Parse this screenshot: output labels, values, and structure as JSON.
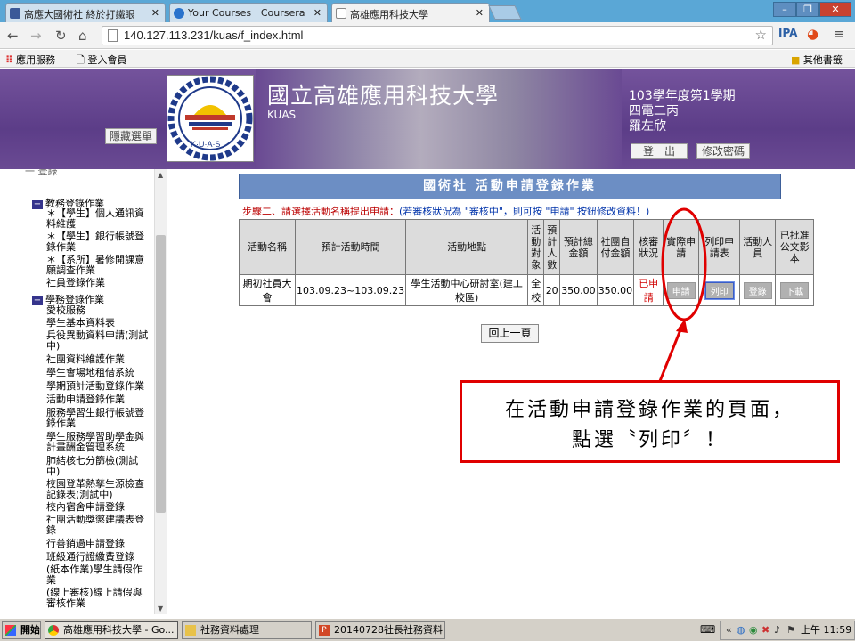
{
  "browser": {
    "tabs": [
      {
        "title": "高應大國術社 終於打鐵眼"
      },
      {
        "title": "Your Courses | Coursera"
      },
      {
        "title": "高雄應用科技大學"
      }
    ],
    "url": "140.127.113.231/kuas/f_index.html",
    "bookmarks": [
      "應用服務",
      "登入會員"
    ],
    "other_bookmarks": "其他書籤"
  },
  "banner": {
    "university": "國立高雄應用科技大學",
    "kuas": "KUAS",
    "hide_menu": "隱藏選單",
    "semester": "103學年度第1學期",
    "class": "四電二丙",
    "name": "羅左欣",
    "logout": "登　出",
    "change_password": "修改密碼"
  },
  "sidebar": {
    "truncated": "一 登錄",
    "sections": [
      {
        "title": "教務登錄作業",
        "items": [
          "＊【學生】個人通訊資料維護",
          "＊【學生】銀行帳號登錄作業",
          "＊【系所】暑修開課意願調查作業",
          "社員登錄作業"
        ]
      },
      {
        "title": "學務登錄作業",
        "items": [
          "愛校服務",
          "學生基本資料表",
          "兵役異動資料申請(測試中)",
          "社團資料維護作業",
          "學生會場地租借系統",
          "學期預計活動登錄作業",
          "活動申請登錄作業",
          "服務學習生銀行帳號登錄作業",
          "學生服務學習助學金與計畫酬金管理系統",
          "肺結核七分篩檢(測試中)",
          "校園登革熱孳生源檢查記錄表(測試中)",
          "校內宿舍申請登錄",
          "社團活動獎懲建議表登錄",
          "行善銷過申請登錄",
          "班級通行證繳費登錄",
          "(紙本作業)學生請假作業",
          "(線上審核)線上請假與審核作業"
        ]
      }
    ]
  },
  "main": {
    "title": "國術社 活動申請登錄作業",
    "step": "步驟二、請選擇活動名稱提出申請：",
    "hint": "(若審核狀況為 \"審核中\"，則可按 \"申請\" 按鈕修改資料！)",
    "headers": [
      "活動名稱",
      "預計活動時間",
      "活動地點",
      "活動對象",
      "預計人數",
      "預計總金額",
      "社團自付金額",
      "核審狀況",
      "實際申請",
      "列印申請表",
      "活動人員",
      "已批准公文影本"
    ],
    "row": {
      "name": "期初社員大會",
      "time": "103.09.23~103.09.23",
      "location": "學生活動中心研討室(建工校區)",
      "target": "全校",
      "people": "20",
      "total": "350.00",
      "self_pay": "350.00",
      "status": "已申請",
      "apply_btn": "申請",
      "print_btn": "列印",
      "staff_btn": "登錄",
      "download_btn": "下載"
    },
    "back": "回上一頁"
  },
  "annotation": {
    "line1": "在活動申請登錄作業的頁面，",
    "line2": "點選〝列印〞！",
    "color": "#e00000"
  },
  "taskbar": {
    "start": "開始",
    "items": [
      "高雄應用科技大學 - Go...",
      "社務資料處理",
      "20140728社長社務資料..."
    ],
    "time": "上午 11:59"
  }
}
